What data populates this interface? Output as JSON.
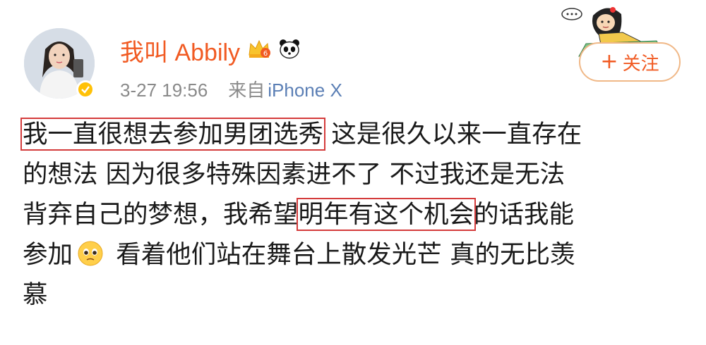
{
  "post": {
    "username": "我叫 Abbily",
    "timestamp": "3-27 19:56",
    "source_prefix": "来自",
    "source_device": "iPhone X",
    "follow_label": "关注",
    "follow_plus": "+",
    "content": {
      "line1_highlight": "我一直很想去参加男团选秀",
      "line1_rest": " 这是很久以来一直存在",
      "line2": "的想法  因为很多特殊因素进不了  不过我还是无法",
      "line3_pre": "背弃自己的梦想，我希望",
      "line3_highlight": "明年有这个机会",
      "line3_post": "的话我能",
      "line4_pre": "参加",
      "line4_post": " 看着他们站在舞台上散发光芒 真的无比羡",
      "line5": "慕"
    },
    "icons": {
      "crown": "vip-crown-icon",
      "crown_level": "6",
      "panda": "panda-icon",
      "emoji": "pleading-face-emoji-icon",
      "verified": "verified-badge-icon",
      "sticker": "cartoon-girl-sticker-icon"
    },
    "colors": {
      "username": "#f15a22",
      "meta": "#8a8a8a",
      "source": "#5b7fb5",
      "highlight_border": "#d43b3b",
      "follow_border": "#f0b887"
    }
  }
}
